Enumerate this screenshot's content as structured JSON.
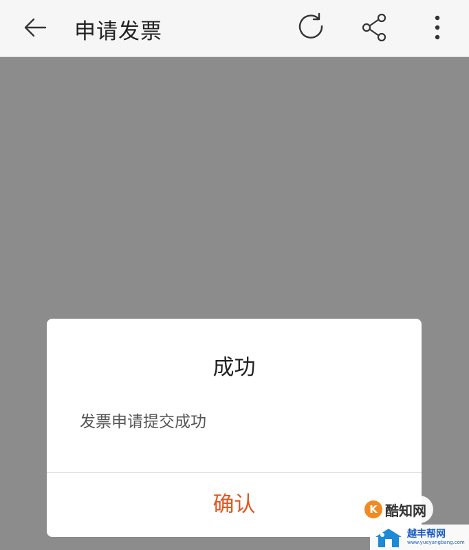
{
  "appbar": {
    "title": "申请发票",
    "icons": [
      "back-arrow-icon",
      "refresh-icon",
      "share-icon",
      "more-vertical-icon"
    ]
  },
  "dialog": {
    "title": "成功",
    "message": "发票申请提交成功",
    "confirm_label": "确认",
    "confirm_color": "#e0581f"
  },
  "watermark": {
    "logo1_text": "酷知网",
    "logo2_text": "越丰帮网",
    "logo2_url": "www.yueyangbang.com"
  },
  "colors": {
    "appbar_bg": "#f6f6f6",
    "overlay_bg": "#8c8c8c",
    "dialog_bg": "#ffffff"
  }
}
